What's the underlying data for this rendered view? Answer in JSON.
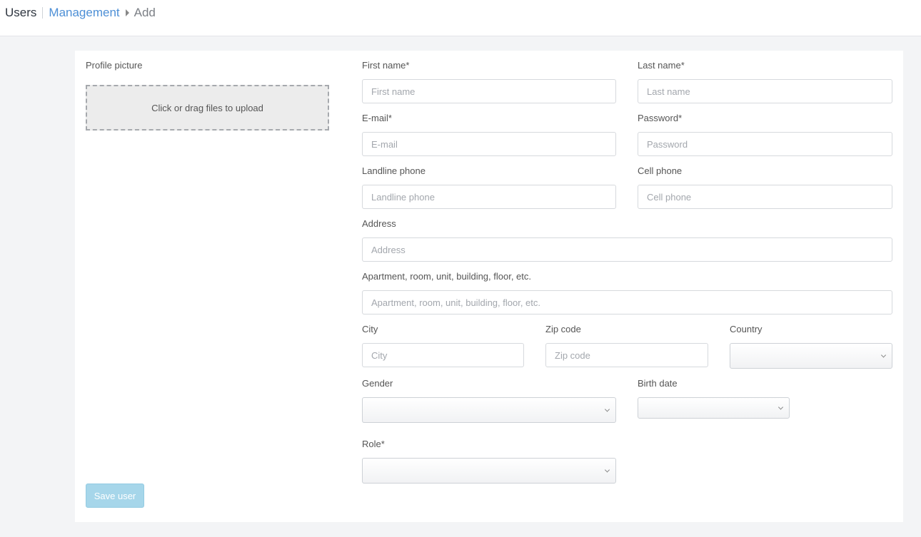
{
  "breadcrumb": {
    "root": "Users",
    "section": "Management",
    "current": "Add"
  },
  "form": {
    "profile_picture_label": "Profile picture",
    "upload_text": "Click or drag files to upload",
    "first_name": {
      "label": "First name*",
      "placeholder": "First name",
      "value": ""
    },
    "last_name": {
      "label": "Last name*",
      "placeholder": "Last name",
      "value": ""
    },
    "email": {
      "label": "E-mail*",
      "placeholder": "E-mail",
      "value": ""
    },
    "password": {
      "label": "Password*",
      "placeholder": "Password",
      "value": ""
    },
    "landline": {
      "label": "Landline phone",
      "placeholder": "Landline phone",
      "value": ""
    },
    "cell": {
      "label": "Cell phone",
      "placeholder": "Cell phone",
      "value": ""
    },
    "address": {
      "label": "Address",
      "placeholder": "Address",
      "value": ""
    },
    "address2": {
      "label": "Apartment, room, unit, building, floor, etc.",
      "placeholder": "Apartment, room, unit, building, floor, etc.",
      "value": ""
    },
    "city": {
      "label": "City",
      "placeholder": "City",
      "value": ""
    },
    "zip": {
      "label": "Zip code",
      "placeholder": "Zip code",
      "value": ""
    },
    "country": {
      "label": "Country",
      "selected": ""
    },
    "gender": {
      "label": "Gender",
      "selected": ""
    },
    "birth_date": {
      "label": "Birth date",
      "selected": ""
    },
    "role": {
      "label": "Role*",
      "selected": ""
    },
    "save_label": "Save user"
  },
  "colors": {
    "link": "#4d8fd6",
    "save_button_bg": "#a6d6ea",
    "page_bg": "#f3f4f6"
  },
  "icons": {
    "breadcrumb_separator": "caret-right-icon",
    "select_arrow": "chevron-down-icon"
  }
}
